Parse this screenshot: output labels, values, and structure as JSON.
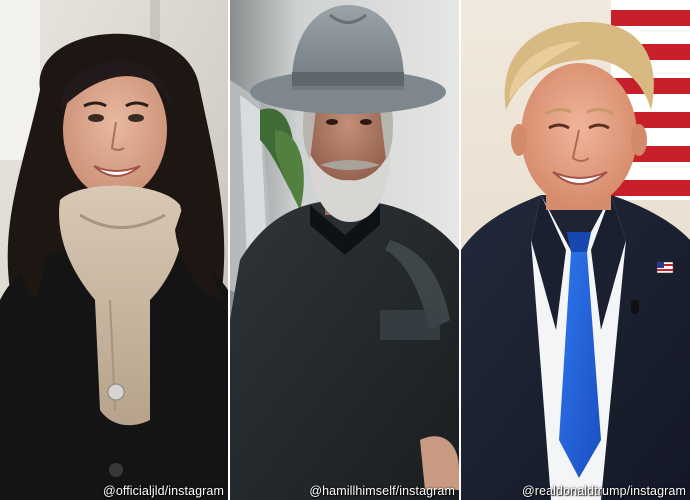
{
  "panels": [
    {
      "credit": "@officialjld/instagram"
    },
    {
      "credit": "@hamillhimself/instagram"
    },
    {
      "credit": "@realdonaldtrump/instagram"
    }
  ],
  "colors": {
    "divider": "#ffffff",
    "credit_text": "#ffffff",
    "tie_blue": "#1e5fd6",
    "flag_red": "#c8202a"
  }
}
